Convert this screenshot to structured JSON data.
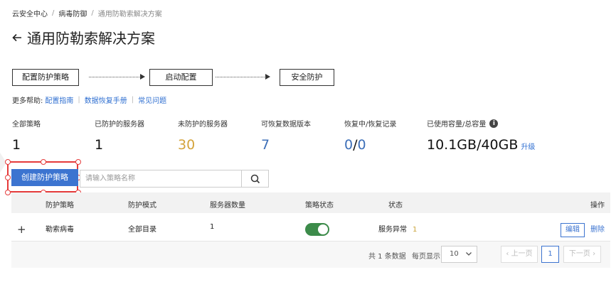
{
  "breadcrumb": {
    "items": [
      "云安全中心",
      "病毒防御",
      "通用防勒索解决方案"
    ],
    "separator": "/"
  },
  "page": {
    "title": "通用防勒索解决方案"
  },
  "flow": {
    "steps": [
      "配置防护策略",
      "启动配置",
      "安全防护"
    ]
  },
  "help": {
    "label": "更多帮助:",
    "links": [
      "配置指南",
      "数据恢复手册",
      "常见问题"
    ]
  },
  "stats": [
    {
      "label": "全部策略",
      "value": "1"
    },
    {
      "label": "已防护的服务器",
      "value": "1"
    },
    {
      "label": "未防护的服务器",
      "value": "30"
    },
    {
      "label": "可恢复数据版本",
      "value": "7"
    },
    {
      "label": "恢复中/恢复记录",
      "value_a": "0",
      "value_sep": "/",
      "value_b": "0"
    },
    {
      "label": "已使用容量/总容量",
      "value": "10.1GB/40GB",
      "upgrade": "升级"
    }
  ],
  "toolbar": {
    "create_label": "创建防护策略",
    "search_placeholder": "请输入策略名称"
  },
  "table": {
    "columns": [
      "防护策略",
      "防护模式",
      "服务器数量",
      "策略状态",
      "状态",
      "操作"
    ],
    "rows": [
      {
        "policy": "勒索病毒",
        "mode": "全部目录",
        "servers": "1",
        "enabled": true,
        "status_text": "服务异常",
        "status_count": "1",
        "edit": "编辑",
        "delete": "删除"
      }
    ]
  },
  "pagination": {
    "total_text": "共 1 条数据",
    "per_page_label": "每页显示",
    "per_page_value": "10",
    "prev": "上一页",
    "next": "下一页",
    "current_page": "1"
  },
  "colors": {
    "primary": "#3c74d0",
    "link": "#2f6fd1",
    "orange": "#d4a43c",
    "toggle_on": "#3c8b4a",
    "highlight": "#e53b3b"
  }
}
